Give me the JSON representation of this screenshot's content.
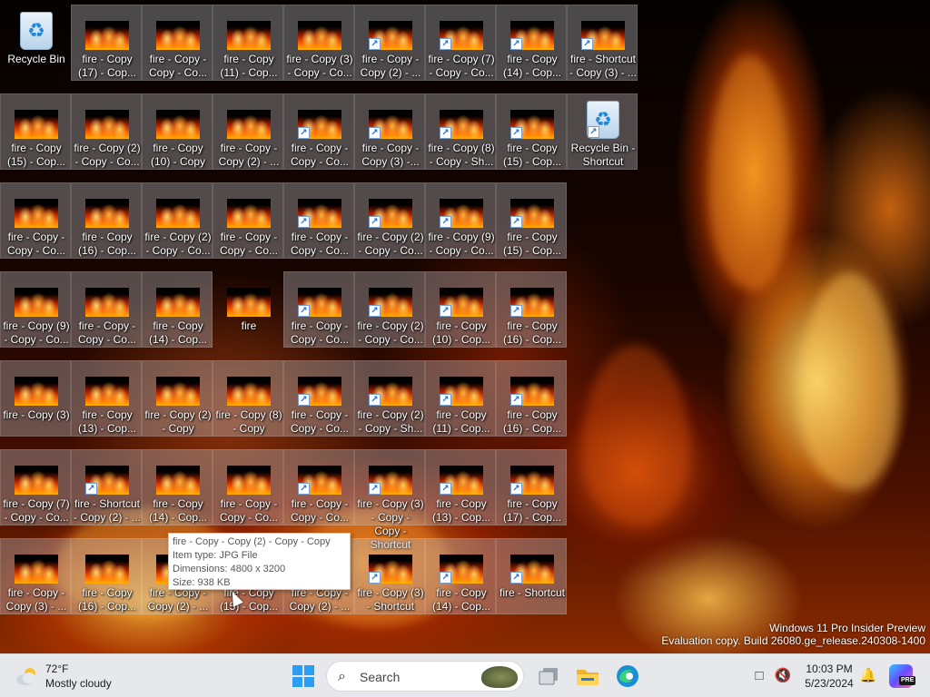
{
  "desktop": {
    "icons": [
      {
        "label": "Recycle Bin",
        "kind": "recycle",
        "col": 0,
        "row": 0,
        "shortcut": false
      },
      {
        "label": "fire - Copy\n(17) - Cop...",
        "kind": "image",
        "col": 1,
        "row": 0,
        "shortcut": false
      },
      {
        "label": "fire - Copy -\nCopy - Co...",
        "kind": "image",
        "col": 2,
        "row": 0,
        "shortcut": false
      },
      {
        "label": "fire - Copy\n(11) - Cop...",
        "kind": "image",
        "col": 3,
        "row": 0,
        "shortcut": false
      },
      {
        "label": "fire - Copy (3)\n- Copy - Co...",
        "kind": "image",
        "col": 4,
        "row": 0,
        "shortcut": false
      },
      {
        "label": "fire - Copy -\nCopy (2) - ...",
        "kind": "image",
        "col": 5,
        "row": 0,
        "shortcut": true
      },
      {
        "label": "fire - Copy (7)\n- Copy - Co...",
        "kind": "image",
        "col": 6,
        "row": 0,
        "shortcut": true
      },
      {
        "label": "fire - Copy\n(14) - Cop...",
        "kind": "image",
        "col": 7,
        "row": 0,
        "shortcut": true
      },
      {
        "label": "fire - Shortcut\n- Copy (3) - ...",
        "kind": "image",
        "col": 8,
        "row": 0,
        "shortcut": true
      },
      {
        "label": "fire - Copy\n(15) - Cop...",
        "kind": "image",
        "col": 0,
        "row": 1,
        "shortcut": false
      },
      {
        "label": "fire - Copy (2)\n- Copy - Co...",
        "kind": "image",
        "col": 1,
        "row": 1,
        "shortcut": false
      },
      {
        "label": "fire - Copy\n(10) - Copy",
        "kind": "image",
        "col": 2,
        "row": 1,
        "shortcut": false
      },
      {
        "label": "fire - Copy -\nCopy (2) - ...",
        "kind": "image",
        "col": 3,
        "row": 1,
        "shortcut": false
      },
      {
        "label": "fire - Copy -\nCopy - Co...",
        "kind": "image",
        "col": 4,
        "row": 1,
        "shortcut": true
      },
      {
        "label": "fire - Copy -\nCopy (3) -...",
        "kind": "image",
        "col": 5,
        "row": 1,
        "shortcut": true
      },
      {
        "label": "fire - Copy (8)\n- Copy - Sh...",
        "kind": "image",
        "col": 6,
        "row": 1,
        "shortcut": true
      },
      {
        "label": "fire - Copy\n(15) - Cop...",
        "kind": "image",
        "col": 7,
        "row": 1,
        "shortcut": true
      },
      {
        "label": "Recycle Bin -\nShortcut",
        "kind": "recycle",
        "col": 8,
        "row": 1,
        "shortcut": true
      },
      {
        "label": "fire - Copy -\nCopy - Co...",
        "kind": "image",
        "col": 0,
        "row": 2,
        "shortcut": false
      },
      {
        "label": "fire - Copy\n(16) - Cop...",
        "kind": "image",
        "col": 1,
        "row": 2,
        "shortcut": false
      },
      {
        "label": "fire - Copy (2)\n- Copy - Co...",
        "kind": "image",
        "col": 2,
        "row": 2,
        "shortcut": false
      },
      {
        "label": "fire - Copy -\nCopy - Co...",
        "kind": "image",
        "col": 3,
        "row": 2,
        "shortcut": false
      },
      {
        "label": "fire - Copy -\nCopy - Co...",
        "kind": "image",
        "col": 4,
        "row": 2,
        "shortcut": true
      },
      {
        "label": "fire - Copy (2)\n- Copy - Co...",
        "kind": "image",
        "col": 5,
        "row": 2,
        "shortcut": true
      },
      {
        "label": "fire - Copy (9)\n- Copy - Co...",
        "kind": "image",
        "col": 6,
        "row": 2,
        "shortcut": true
      },
      {
        "label": "fire - Copy\n(15) - Cop...",
        "kind": "image",
        "col": 7,
        "row": 2,
        "shortcut": true
      },
      {
        "label": "fire - Copy (9)\n- Copy - Co...",
        "kind": "image",
        "col": 0,
        "row": 3,
        "shortcut": false
      },
      {
        "label": "fire - Copy -\nCopy - Co...",
        "kind": "image",
        "col": 1,
        "row": 3,
        "shortcut": false
      },
      {
        "label": "fire - Copy\n(14) - Cop...",
        "kind": "image",
        "col": 2,
        "row": 3,
        "shortcut": false
      },
      {
        "label": "fire",
        "kind": "image",
        "col": 3,
        "row": 3,
        "shortcut": false
      },
      {
        "label": "fire - Copy -\nCopy - Co...",
        "kind": "image",
        "col": 4,
        "row": 3,
        "shortcut": true
      },
      {
        "label": "fire - Copy (2)\n- Copy - Co...",
        "kind": "image",
        "col": 5,
        "row": 3,
        "shortcut": true
      },
      {
        "label": "fire - Copy\n(10) - Cop...",
        "kind": "image",
        "col": 6,
        "row": 3,
        "shortcut": true
      },
      {
        "label": "fire - Copy\n(16) - Cop...",
        "kind": "image",
        "col": 7,
        "row": 3,
        "shortcut": true
      },
      {
        "label": "fire - Copy (3)",
        "kind": "image",
        "col": 0,
        "row": 4,
        "shortcut": false
      },
      {
        "label": "fire - Copy\n(13) - Cop...",
        "kind": "image",
        "col": 1,
        "row": 4,
        "shortcut": false
      },
      {
        "label": "fire - Copy (2)\n- Copy",
        "kind": "image",
        "col": 2,
        "row": 4,
        "shortcut": false
      },
      {
        "label": "fire - Copy (8)\n- Copy",
        "kind": "image",
        "col": 3,
        "row": 4,
        "shortcut": false
      },
      {
        "label": "fire - Copy -\nCopy - Co...",
        "kind": "image",
        "col": 4,
        "row": 4,
        "shortcut": true
      },
      {
        "label": "fire - Copy (2)\n- Copy - Sh...",
        "kind": "image",
        "col": 5,
        "row": 4,
        "shortcut": true
      },
      {
        "label": "fire - Copy\n(11) - Cop...",
        "kind": "image",
        "col": 6,
        "row": 4,
        "shortcut": true
      },
      {
        "label": "fire - Copy\n(16) - Cop...",
        "kind": "image",
        "col": 7,
        "row": 4,
        "shortcut": true
      },
      {
        "label": "fire - Copy (7)\n- Copy - Co...",
        "kind": "image",
        "col": 0,
        "row": 5,
        "shortcut": false
      },
      {
        "label": "fire - Shortcut\n- Copy (2) - ...",
        "kind": "image",
        "col": 1,
        "row": 5,
        "shortcut": true
      },
      {
        "label": "fire - Copy\n(14) - Cop...",
        "kind": "image",
        "col": 2,
        "row": 5,
        "shortcut": false
      },
      {
        "label": "fire - Copy -\nCopy - Co...",
        "kind": "image",
        "col": 3,
        "row": 5,
        "shortcut": false
      },
      {
        "label": "fire - Copy -\nCopy - Co...",
        "kind": "image",
        "col": 4,
        "row": 5,
        "shortcut": true
      },
      {
        "label": "fire - Copy (3)\n- Copy -\nCopy -\nShortcut",
        "kind": "image",
        "col": 5,
        "row": 5,
        "shortcut": true
      },
      {
        "label": "fire - Copy\n(13) - Cop...",
        "kind": "image",
        "col": 6,
        "row": 5,
        "shortcut": true
      },
      {
        "label": "fire - Copy\n(17) - Cop...",
        "kind": "image",
        "col": 7,
        "row": 5,
        "shortcut": true
      },
      {
        "label": "fire - Copy -\nCopy (3) - ...",
        "kind": "image",
        "col": 0,
        "row": 6,
        "shortcut": false
      },
      {
        "label": "fire - Copy\n(16) - Cop...",
        "kind": "image",
        "col": 1,
        "row": 6,
        "shortcut": false
      },
      {
        "label": "fire - Copy -\nCopy (2) - ...",
        "kind": "image",
        "col": 2,
        "row": 6,
        "shortcut": false
      },
      {
        "label": "fire - Copy\n(15) - Cop...",
        "kind": "image",
        "col": 3,
        "row": 6,
        "shortcut": false
      },
      {
        "label": "fire - Copy -\nCopy (2) - ...",
        "kind": "image",
        "col": 4,
        "row": 6,
        "shortcut": true
      },
      {
        "label": "fire - Copy (3)\n- Shortcut",
        "kind": "image",
        "col": 5,
        "row": 6,
        "shortcut": true
      },
      {
        "label": "fire - Copy\n(14) - Cop...",
        "kind": "image",
        "col": 6,
        "row": 6,
        "shortcut": true
      },
      {
        "label": "fire - Shortcut",
        "kind": "image",
        "col": 7,
        "row": 6,
        "shortcut": true
      }
    ]
  },
  "tooltip": {
    "name": "fire - Copy - Copy (2) - Copy - Copy",
    "type": "Item type: JPG File",
    "dimensions": "Dimensions: 4800 x 3200",
    "size": "Size: 938 KB"
  },
  "watermark": {
    "line1": "Windows 11 Pro Insider Preview",
    "line2": "Evaluation copy. Build 26080.ge_release.240308-1400"
  },
  "taskbar": {
    "weather": {
      "temp": "72°F",
      "condition": "Mostly cloudy",
      "icon": "partly-cloudy-icon"
    },
    "search_label": "Search",
    "apps": [
      "task-view-icon",
      "file-explorer-icon",
      "edge-icon"
    ],
    "tray": {
      "icons": [
        "display-icon",
        "volume-muted-icon",
        "notifications-bell-icon"
      ]
    },
    "clock": {
      "time": "10:03 PM",
      "date": "5/23/2024"
    },
    "copilot_badge": "PRE"
  }
}
